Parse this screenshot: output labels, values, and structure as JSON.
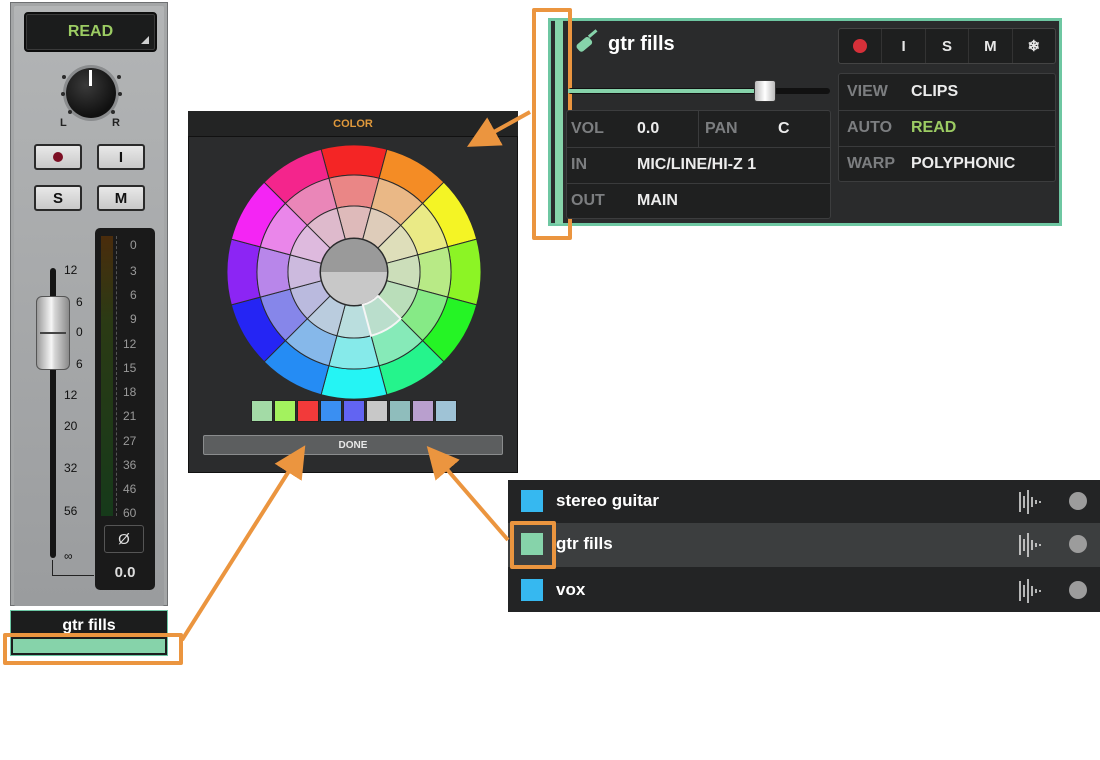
{
  "channel_strip": {
    "automation_mode": "READ",
    "pan_left_label": "L",
    "pan_right_label": "R",
    "buttons": {
      "record": "●",
      "input": "I",
      "solo": "S",
      "mute": "M"
    },
    "fader_scale": [
      "12",
      "6",
      "0",
      "6",
      "12",
      "20",
      "32",
      "56",
      "∞"
    ],
    "meter_scale": [
      "0",
      "3",
      "6",
      "9",
      "12",
      "15",
      "18",
      "21",
      "27",
      "36",
      "46",
      "60"
    ],
    "phase_symbol": "Ø",
    "volume_readout": "0.0",
    "track_name": "gtr fills",
    "track_color": "#86d3aa"
  },
  "color_picker": {
    "title": "COLOR",
    "swatches": [
      "#a3dba6",
      "#a3f25e",
      "#f23a3a",
      "#3a8ff2",
      "#6264f2",
      "#c8c8c8",
      "#8fbdbc",
      "#b99fce",
      "#9fc3d6"
    ],
    "done_label": "DONE"
  },
  "track_header": {
    "name": "gtr fills",
    "buttons": [
      "●",
      "I",
      "S",
      "M",
      "❄"
    ],
    "rows_left": [
      {
        "label": "VOL",
        "value": "0.0",
        "label2": "PAN",
        "value2": "C"
      },
      {
        "label": "IN",
        "value": "MIC/LINE/HI-Z 1"
      },
      {
        "label": "OUT",
        "value": "MAIN"
      }
    ],
    "rows_right": [
      {
        "label": "VIEW",
        "value": "CLIPS"
      },
      {
        "label": "AUTO",
        "value": "READ"
      },
      {
        "label": "WARP",
        "value": "POLYPHONIC"
      }
    ],
    "auto_value_color": "#9ccc63"
  },
  "track_list": [
    {
      "name": "stereo guitar",
      "color": "#36b8f0"
    },
    {
      "name": "gtr fills",
      "color": "#86d3aa"
    },
    {
      "name": "vox",
      "color": "#36b8f0"
    }
  ],
  "highlight_color": "#eb953f"
}
